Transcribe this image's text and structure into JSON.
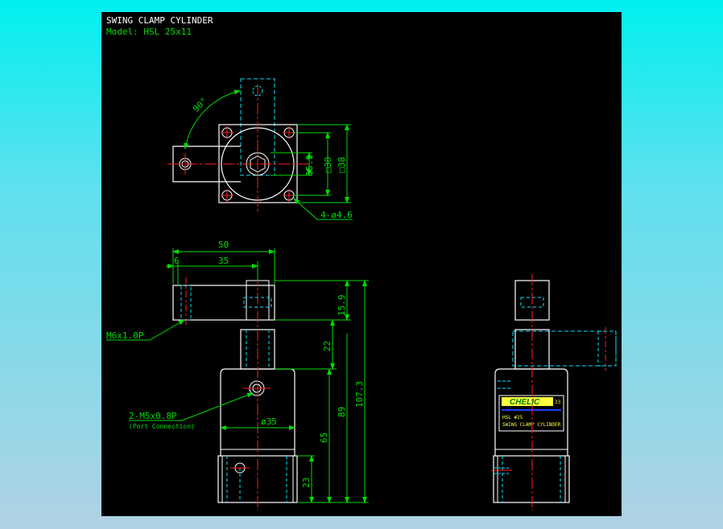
{
  "header": {
    "title": "SWING CLAMP CYLINDER",
    "model": "Model: HSL 25x11"
  },
  "top_view": {
    "angle": "90°",
    "dim_15_9": "15.9",
    "dim_30": "□30",
    "dim_38": "□38",
    "holes": "4-ø4.6"
  },
  "front_view": {
    "dim_50": "50",
    "dim_6": "6",
    "dim_35": "35",
    "dim_15_9": "15.9",
    "dim_22": "22",
    "dim_107_3": "107.3",
    "dim_89": "89",
    "dim_65": "65",
    "dim_23": "23",
    "dia_35": "ø35",
    "thread": "M6x1.0P",
    "port": "2-M5x0.8P",
    "port_note": "(Port Connection)"
  },
  "side_view": {
    "brand": "CHELIC",
    "badge": "33",
    "model_label": "HSL #25",
    "product_label": "SWING CLAMP CYLINDER"
  },
  "colors": {
    "outline": "#ffffff",
    "center": "#ff2020",
    "dimension": "#00dd00",
    "hidden": "#00e5ff",
    "label_bg": "#ffff40",
    "brand": "#008000"
  }
}
